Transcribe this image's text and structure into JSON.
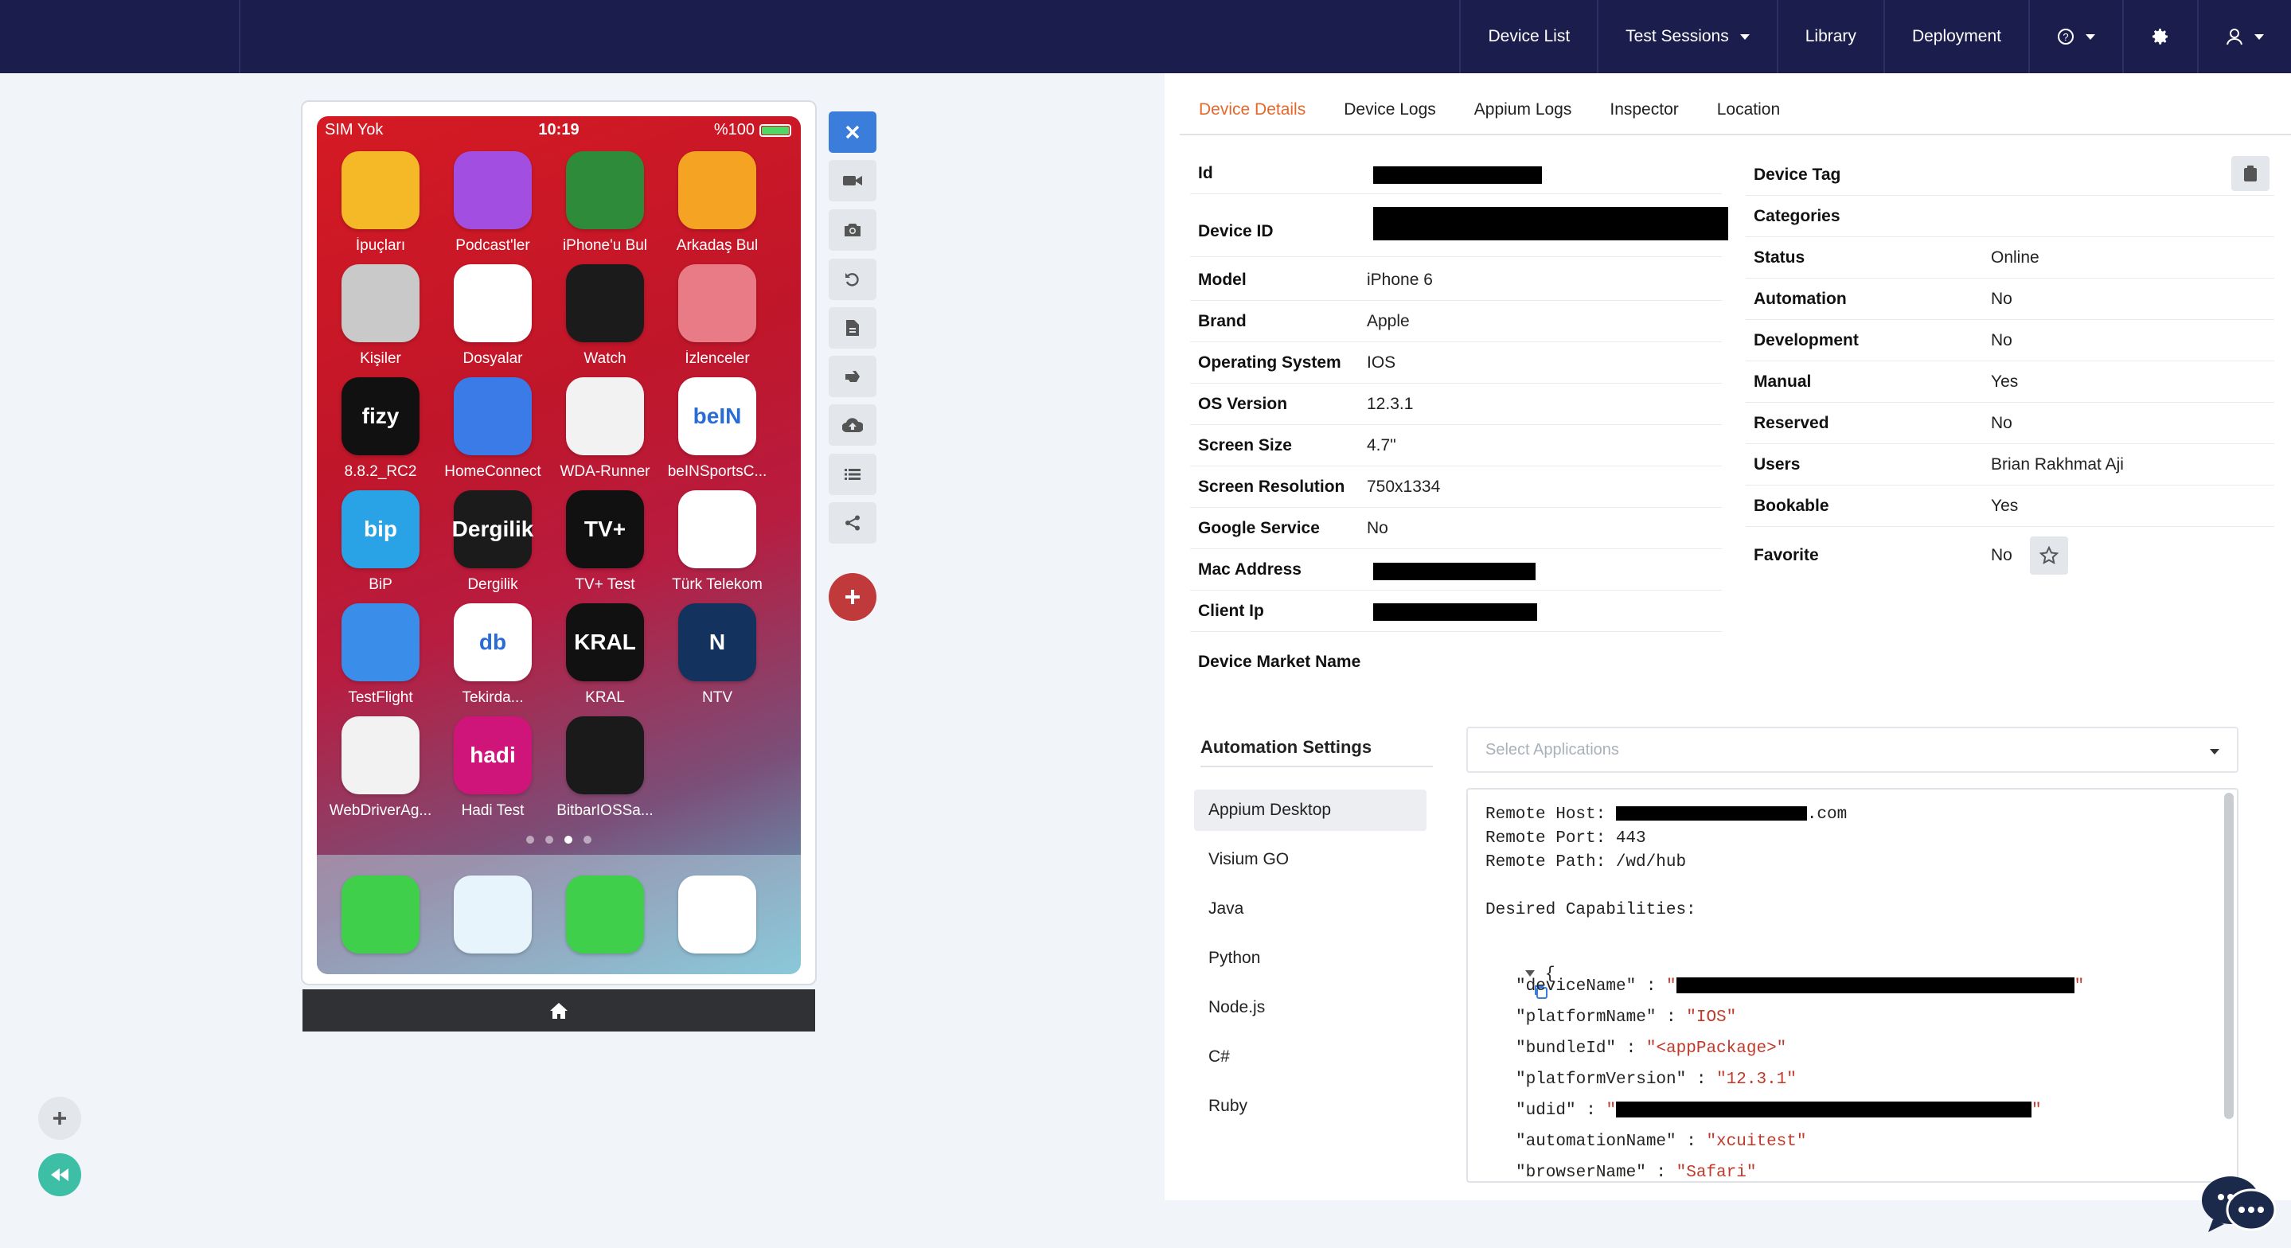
{
  "nav": {
    "items": [
      "Device List",
      "Test Sessions",
      "Library",
      "Deployment"
    ]
  },
  "phone": {
    "status": {
      "carrier": "SIM Yok",
      "time": "10:19",
      "battery": "%100"
    },
    "apps": [
      {
        "label": "İpuçları",
        "bg": "#f5b826",
        "glyph": ""
      },
      {
        "label": "Podcast'ler",
        "bg": "#a24ee0",
        "glyph": ""
      },
      {
        "label": "iPhone'u Bul",
        "bg": "#2e8b3a",
        "glyph": ""
      },
      {
        "label": "Arkadaş Bul",
        "bg": "#f4a323",
        "glyph": ""
      },
      {
        "label": "Kişiler",
        "bg": "#c9c9c9",
        "glyph": ""
      },
      {
        "label": "Dosyalar",
        "bg": "#ffffff",
        "glyph": ""
      },
      {
        "label": "Watch",
        "bg": "#1b1b1b",
        "glyph": ""
      },
      {
        "label": "İzlenceler",
        "bg": "#e87b86",
        "glyph": ""
      },
      {
        "label": "8.8.2_RC2",
        "bg": "#111111",
        "glyph": "fizy"
      },
      {
        "label": "HomeConnect",
        "bg": "#3a7be8",
        "glyph": ""
      },
      {
        "label": "WDA-Runner",
        "bg": "#f2f2f2",
        "glyph": ""
      },
      {
        "label": "beINSportsC...",
        "bg": "#ffffff",
        "glyph": "beIN"
      },
      {
        "label": "BiP",
        "bg": "#2aa3e6",
        "glyph": "bip"
      },
      {
        "label": "Dergilik",
        "bg": "#1b1b1b",
        "glyph": "Dergilik"
      },
      {
        "label": "TV+ Test",
        "bg": "#111111",
        "glyph": "TV+"
      },
      {
        "label": "Türk Telekom",
        "bg": "#ffffff",
        "glyph": ""
      },
      {
        "label": "TestFlight",
        "bg": "#3a8de8",
        "glyph": ""
      },
      {
        "label": "Tekirda...",
        "bg": "#ffffff",
        "glyph": "db"
      },
      {
        "label": "KRAL",
        "bg": "#111111",
        "glyph": "KRAL"
      },
      {
        "label": "NTV",
        "bg": "#13335e",
        "glyph": "N"
      },
      {
        "label": "WebDriverAg...",
        "bg": "#f2f2f2",
        "glyph": ""
      },
      {
        "label": "Hadi Test",
        "bg": "#d0157a",
        "glyph": "hadi"
      },
      {
        "label": "BitbarIOSSa...",
        "bg": "#1a1a1a",
        "glyph": ""
      }
    ],
    "dock": [
      {
        "name": "phone-app-icon",
        "bg": "#3fcf4a"
      },
      {
        "name": "safari-app-icon",
        "bg": "#e8f4fb"
      },
      {
        "name": "messages-app-icon",
        "bg": "#3fcf4a"
      },
      {
        "name": "music-app-icon",
        "bg": "#ffffff"
      }
    ]
  },
  "tabs": [
    "Device Details",
    "Device Logs",
    "Appium Logs",
    "Inspector",
    "Location"
  ],
  "details_left": [
    {
      "k": "Id",
      "v": ""
    },
    {
      "k": "Device ID",
      "v": ""
    },
    {
      "k": "Model",
      "v": "iPhone 6"
    },
    {
      "k": "Brand",
      "v": "Apple"
    },
    {
      "k": "Operating System",
      "v": "IOS"
    },
    {
      "k": "OS Version",
      "v": "12.3.1"
    },
    {
      "k": "Screen Size",
      "v": "4.7\""
    },
    {
      "k": "Screen Resolution",
      "v": "750x1334"
    },
    {
      "k": "Google Service",
      "v": "No"
    },
    {
      "k": "Mac Address",
      "v": ""
    },
    {
      "k": "Client Ip",
      "v": ""
    },
    {
      "k": "Device Market Name",
      "v": ""
    }
  ],
  "details_right": [
    {
      "k": "Device Tag",
      "v": ""
    },
    {
      "k": "Categories",
      "v": ""
    },
    {
      "k": "Status",
      "v": "Online"
    },
    {
      "k": "Automation",
      "v": "No"
    },
    {
      "k": "Development",
      "v": "No"
    },
    {
      "k": "Manual",
      "v": "Yes"
    },
    {
      "k": "Reserved",
      "v": "No"
    },
    {
      "k": "Users",
      "v": "Brian Rakhmat Aji"
    },
    {
      "k": "Bookable",
      "v": "Yes"
    },
    {
      "k": "Favorite",
      "v": "No"
    }
  ],
  "automation": {
    "title": "Automation Settings",
    "languages": [
      "Appium Desktop",
      "Visium GO",
      "Java",
      "Python",
      "Node.js",
      "C#",
      "Ruby"
    ],
    "select_placeholder": "Select Applications",
    "remote_host_label": "Remote Host: ",
    "remote_host_suffix": ".com",
    "remote_port": "Remote Port: 443",
    "remote_path": "Remote Path: /wd/hub",
    "desired_caps": "Desired Capabilities:",
    "caps": [
      {
        "key": "\"deviceName\"",
        "val": "\""
      },
      {
        "key": "\"platformName\"",
        "val": "\"IOS\""
      },
      {
        "key": "\"bundleId\"",
        "val": "\"<appPackage>\""
      },
      {
        "key": "\"platformVersion\"",
        "val": "\"12.3.1\""
      },
      {
        "key": "\"udid\"",
        "val": "\""
      },
      {
        "key": "\"automationName\"",
        "val": "\"xcuitest\""
      },
      {
        "key": "\"browserName\"",
        "val": "\"Safari\""
      }
    ]
  }
}
